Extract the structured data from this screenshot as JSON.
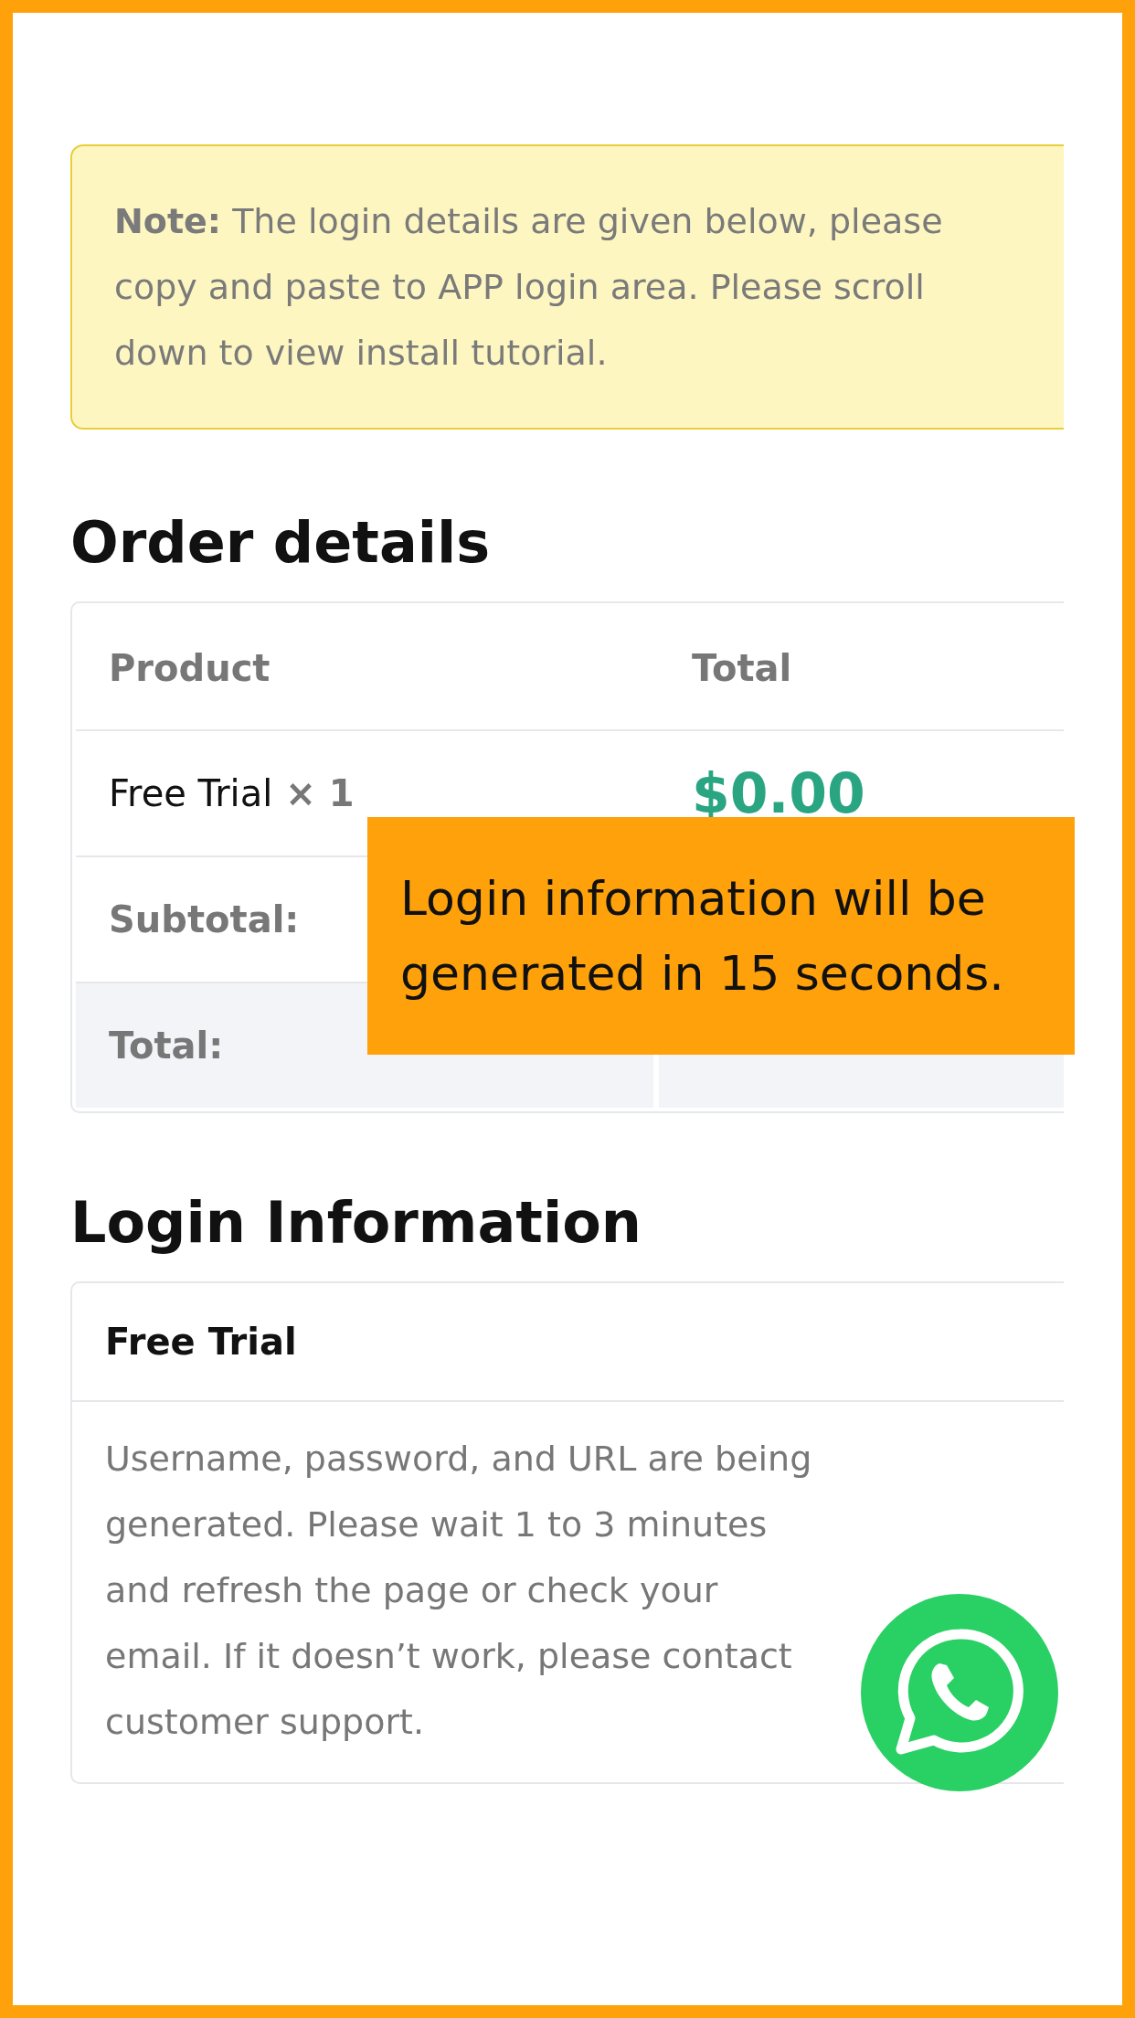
{
  "note": {
    "text": "**Note:** The login details are given below, please copy and paste to APP login area. Please scroll down to view install tutorial."
  },
  "order_details": {
    "title": "Order details",
    "columns": [
      "Product",
      "Total"
    ],
    "rows": [
      {
        "kind": "item",
        "label": "Free Trial",
        "quantity": "× 1",
        "value": "$0.00"
      },
      {
        "kind": "subtotal",
        "label": "Subtotal:"
      },
      {
        "kind": "total",
        "label": "Total:"
      }
    ]
  },
  "login_information": {
    "title": "Login Information",
    "card_title": "Free Trial",
    "message": "Username, password, and URL are being generated. Please wait 1 to 3 minutes and refresh the page or check your email. If it doesn’t work, please contact customer support."
  },
  "overlay": {
    "text": "Login information will be generated in 15 seconds."
  }
}
